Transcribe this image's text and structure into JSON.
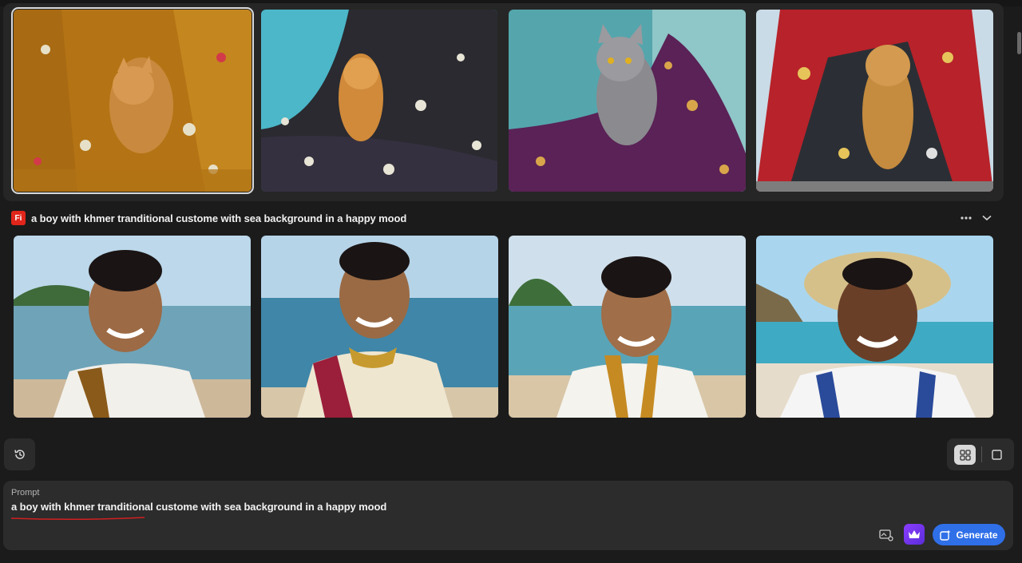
{
  "group1": {
    "images": [
      {
        "alt": "orange cat under yellow floral fabric",
        "selected": true
      },
      {
        "alt": "orange cat in black floral fabric"
      },
      {
        "alt": "grey cat under purple fabric"
      },
      {
        "alt": "orange cat under red patterned fabric"
      }
    ]
  },
  "group2": {
    "badge": "Fi",
    "title": "a boy with khmer tranditional custome with sea background in a happy mood",
    "images": [
      {
        "alt": "smiling boy in white shirt with gold sash at beach"
      },
      {
        "alt": "smiling boy in cream outfit with red sash at sea"
      },
      {
        "alt": "smiling boy in white shirt with embroidered collar"
      },
      {
        "alt": "smiling boy in straw hat at tropical beach"
      }
    ]
  },
  "prompt": {
    "label": "Prompt",
    "value": "a boy with khmer tranditional custome with sea background in a happy mood"
  },
  "actions": {
    "generate_label": "Generate"
  },
  "icons": {
    "history": "history-icon",
    "grid_view": "grid-icon",
    "single_view": "square-icon",
    "more": "more-horizontal-icon",
    "collapse": "chevron-down-icon",
    "style_ref": "image-settings-icon",
    "premium": "crown-icon",
    "generate": "generate-sparkle-icon"
  },
  "colors": {
    "accent": "#2f6fe8",
    "badge": "#e1251b",
    "premium": "#8b3dff"
  }
}
